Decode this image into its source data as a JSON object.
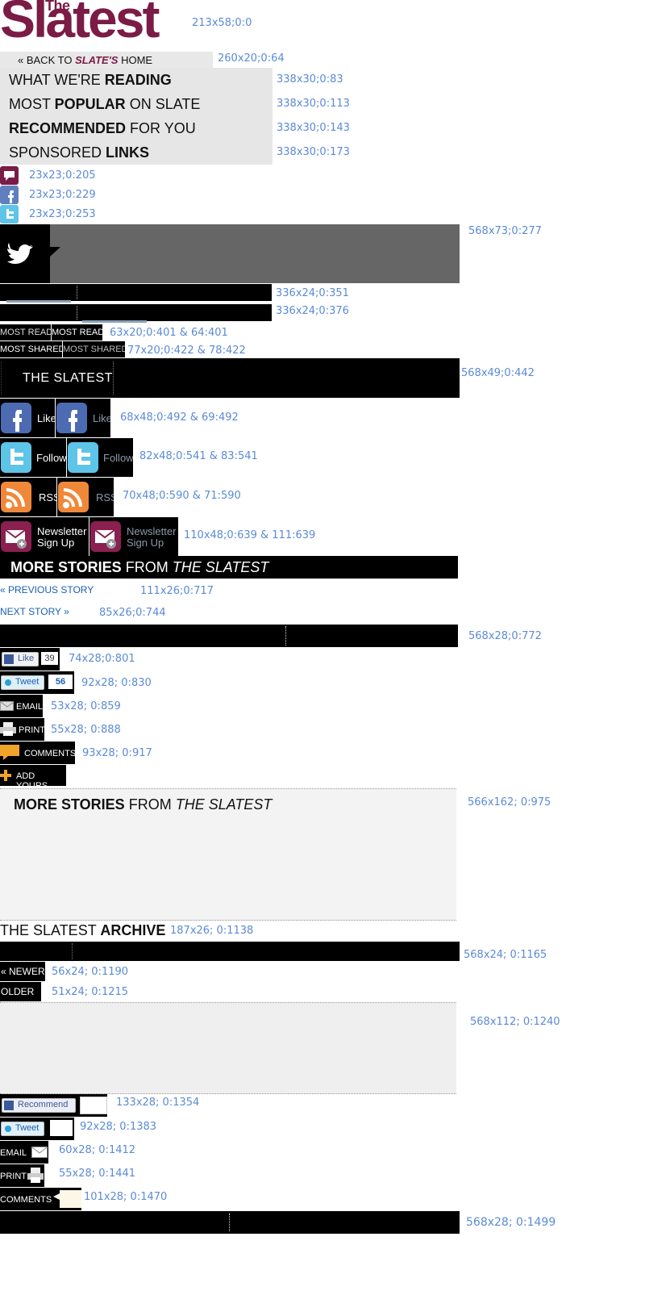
{
  "logo": {
    "the": "The",
    "main": "Slatest"
  },
  "back": {
    "prefix": "« BACK TO ",
    "slate": "SLATE'S",
    "suffix": " HOME"
  },
  "tabs": [
    {
      "pre": "WHAT WE'RE ",
      "bold": "READING",
      "post": ""
    },
    {
      "pre": "MOST ",
      "bold": "POPULAR",
      "post": " ON SLATE"
    },
    {
      "pre": "",
      "bold": "RECOMMENDED",
      "post": " FOR YOU"
    },
    {
      "pre": "SPONSORED ",
      "bold": "LINKS",
      "post": ""
    }
  ],
  "mini_tabs": {
    "most_read": "MOST READ",
    "most_shared": "MOST SHARED"
  },
  "slatest_header": "THE SLATEST",
  "social": {
    "like": "Like",
    "follow": "Follow",
    "rss": "RSS",
    "newsletter1": "Newsletter",
    "newsletter2": "Sign Up"
  },
  "more_stories": {
    "bold": "MORE STORIES",
    "mid": " FROM ",
    "italic": "THE SLATEST"
  },
  "nav": {
    "prev": "« PREVIOUS STORY",
    "next": "NEXT STORY »"
  },
  "share": {
    "like": "Like",
    "like_count": "39",
    "tweet": "Tweet",
    "tweet_count": "56",
    "email": "EMAIL",
    "print": "PRINT",
    "comments": "COMMENTS",
    "add_yours": "ADD YOURS"
  },
  "archive": {
    "pre": "THE SLATEST ",
    "bold": "ARCHIVE"
  },
  "archive_nav": {
    "newer": "« NEWER",
    "older": "OLDER »"
  },
  "bottom_share": {
    "recommend": "Recommend",
    "tweet": "Tweet",
    "email": "EMAIL",
    "print": "PRINT",
    "comments": "COMMENTS"
  },
  "annotations": {
    "a1": "213x58;0:0",
    "a2": "260x20;0:64",
    "a3": "338x30;0:83",
    "a4": "338x30;0:113",
    "a5": "338x30;0:143",
    "a6": "338x30;0:173",
    "a7": "23x23;0:205",
    "a8": "23x23;0:229",
    "a9": "23x23;0:253",
    "a10": "568x73;0:277",
    "a11": "336x24;0:351",
    "a12": "336x24;0:376",
    "a13": "63x20;0:401 & 64:401",
    "a14": "77x20;0:422 & 78:422",
    "a15": "568x49;0:442",
    "a16": "68x48;0:492 & 69:492",
    "a17": "82x48;0:541 & 83:541",
    "a18": "70x48;0:590 & 71:590",
    "a19": "110x48;0:639 & 111:639",
    "a20": "111x26;0:717",
    "a21": "85x26;0:744",
    "a22": "568x28;0:772",
    "a23": "74x28;0:801",
    "a24": "92x28; 0:830",
    "a25": "53x28; 0:859",
    "a26": "55x28; 0:888",
    "a27": "93x28; 0:917",
    "a28": "566x162; 0:975",
    "a29": "187x26; 0:1138",
    "a30": "568x24; 0:1165",
    "a31": "56x24; 0:1190",
    "a32": "51x24; 0:1215",
    "a33": "568x112; 0:1240",
    "a34": "133x28; 0:1354",
    "a35": "92x28; 0:1383",
    "a36": "60x28; 0:1412",
    "a37": "55x28; 0:1441",
    "a38": "101x28; 0:1470",
    "a39": "568x28; 0:1499"
  },
  "colors": {
    "brand": "#7a1c45",
    "link": "#1a5fb4",
    "annotation": "#5b8ad6"
  }
}
